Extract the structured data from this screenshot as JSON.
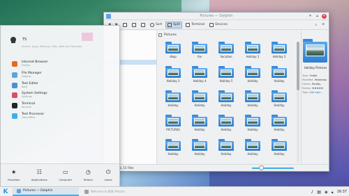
{
  "window": {
    "title": "Pictures — Dolphin",
    "toolbar": {
      "sort_label": "Sort",
      "split_label": "Split",
      "terminal_label": "Terminal",
      "devices_label": "Devices"
    },
    "breadcrumb": "Pictures",
    "sidebar": {
      "items": [
        "",
        "",
        "",
        "",
        "",
        "",
        "",
        "",
        "",
        "",
        "",
        "",
        "",
        "",
        "",
        "",
        "",
        "",
        "",
        "",
        "",
        "",
        "",
        ""
      ],
      "selected_index": 6
    },
    "files": [
      {
        "name": "dkop"
      },
      {
        "name": "fox"
      },
      {
        "name": "Vacation"
      },
      {
        "name": "Holiday 1"
      },
      {
        "name": "Holiday 2"
      },
      {
        "name": "Holiday 3"
      },
      {
        "name": "Holiday 4"
      },
      {
        "name": "Holiday 5"
      },
      {
        "name": "Holiday"
      },
      {
        "name": "Holiday"
      },
      {
        "name": "Holiday"
      },
      {
        "name": "Holiday"
      },
      {
        "name": "Holiday"
      },
      {
        "name": "Holiday"
      },
      {
        "name": "Holiday"
      },
      {
        "name": "PICTURES"
      },
      {
        "name": "Holiday"
      },
      {
        "name": "Holiday"
      },
      {
        "name": "Holiday"
      },
      {
        "name": "Holiday"
      },
      {
        "name": "Holiday"
      },
      {
        "name": "Holiday"
      },
      {
        "name": "Holiday"
      },
      {
        "name": "Holiday"
      },
      {
        "name": "Holiday"
      }
    ],
    "info": {
      "name": "Holiday Pictures",
      "meta": [
        {
          "k": "Type:",
          "v": "Folder"
        },
        {
          "k": "Modified:",
          "v": "Yesterday"
        },
        {
          "k": "Owner:",
          "v": "Reality"
        },
        {
          "k": "Rating:",
          "v": "★★★★★"
        },
        {
          "k": "Tags:",
          "v": "Add tags..."
        }
      ]
    },
    "status": "24 Folders, 15 Files"
  },
  "launcher": {
    "user_name": "TS",
    "search_placeholder": "Search: Apps, Settings, Files, Web and Favorites",
    "apps": [
      {
        "name": "Internet Browser",
        "sub": "Firefox",
        "color": "#e66a1f"
      },
      {
        "name": "File Manager",
        "sub": "Dolphin",
        "color": "#5fa3e3"
      },
      {
        "name": "Text Editor",
        "sub": "Kate",
        "color": "#4a90d9"
      },
      {
        "name": "System Settings",
        "sub": "Settings",
        "color": "#d94f6a"
      },
      {
        "name": "Terminal",
        "sub": "Konsole",
        "color": "#232629"
      },
      {
        "name": "Text Processor",
        "sub": "LibreOffice",
        "color": "#3daee9"
      }
    ],
    "tabs": [
      {
        "label": "Favorites",
        "icon": "★"
      },
      {
        "label": "Applications",
        "icon": "☷"
      },
      {
        "label": "Computer",
        "icon": "▭"
      },
      {
        "label": "History",
        "icon": "◷"
      },
      {
        "label": "Leave",
        "icon": "⏻"
      }
    ]
  },
  "taskbar": {
    "start_icon": "K",
    "task1": "Pictures — Dolphin",
    "task2": "Welcome to KDE Plasma",
    "clock": "16:37"
  }
}
